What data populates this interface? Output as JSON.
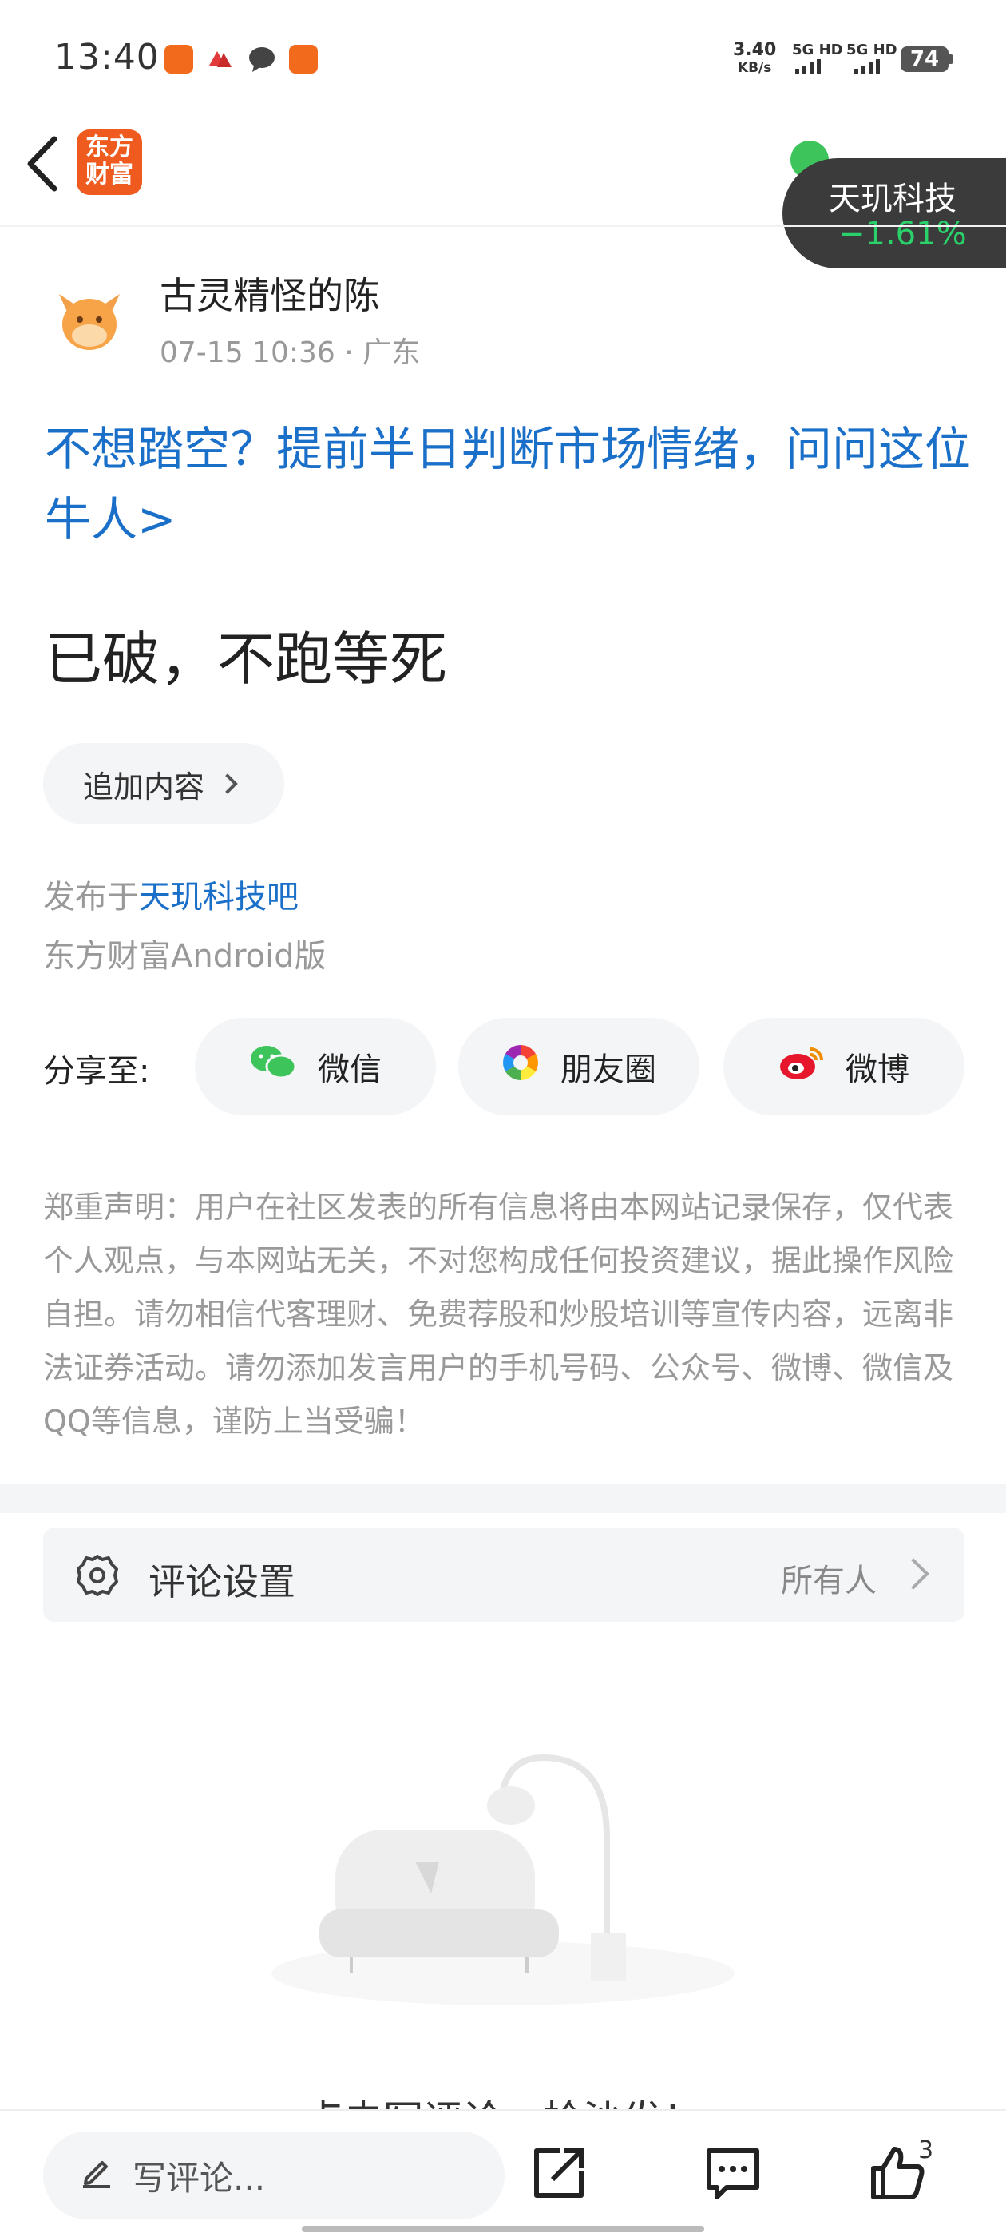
{
  "status_bar": {
    "time": "13:40",
    "net_speed": "3.40",
    "net_unit": "KB/s",
    "sim1": "5G HD",
    "sim2": "5G HD",
    "battery": "74"
  },
  "nav": {
    "app_logo_text": "东方财富",
    "stock_name": "天玑科技",
    "stock_change": "−1.61%",
    "stock_change_color": "#2ad06a"
  },
  "post": {
    "author": "古灵精怪的陈",
    "meta": "07-15 10:36 · 广东",
    "promo": "不想踏空？提前半日判断市场情绪，问问这位牛人>",
    "body": "已破，不跑等死",
    "append_label": "追加内容",
    "published_prefix": "发布于",
    "published_forum": "天玑科技吧",
    "client": "东方财富Android版"
  },
  "share": {
    "label": "分享至:",
    "wechat": "微信",
    "moments": "朋友圈",
    "weibo": "微博"
  },
  "disclaimer": "郑重声明：用户在社区发表的所有信息将由本网站记录保存，仅代表个人观点，与本网站无关，不对您构成任何投资建议，据此操作风险自担。请勿相信代客理财、免费荐股和炒股培训等宣传内容，远离非法证券活动。请勿添加发言用户的手机号码、公众号、微博、微信及QQ等信息，谨防上当受骗！",
  "comment_settings": {
    "label": "评论设置",
    "value": "所有人"
  },
  "empty_state": {
    "text": "点击写评论，抢沙发！"
  },
  "bottom_bar": {
    "input_placeholder": "写评论...",
    "like_count": "3"
  },
  "colors": {
    "link_blue": "#1a6fc8",
    "brand_orange": "#ef5b1f"
  }
}
